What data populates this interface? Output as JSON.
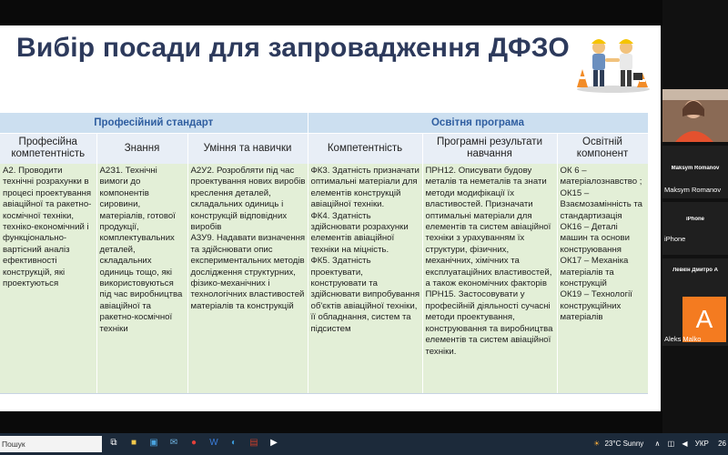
{
  "slide": {
    "title": "Вибір посади для запровадження ДФЗО"
  },
  "table": {
    "group_headers": [
      "Професійний стандарт",
      "Освітня програма"
    ],
    "columns": [
      "Професійна компетентність",
      "Знання",
      "Уміння та навички",
      "Компетентність",
      "Програмні результати навчання",
      "Освітній компонент"
    ],
    "row": [
      "А2. Проводити технічні розрахунки в процесі проектування авіаційної та ракетно-космічної техніки, техніко-економічний і функціонально-вартісний аналіз ефективності конструкцій, які проектуються",
      "А2З1. Технічні вимоги до компонентів сировини, матеріалів, готової продукції, комплектувальних деталей, складальних одиниць тощо, які використовуються під час виробництва авіаційної та ракетно-космічної техніки",
      "А2У2. Розробляти під час проектування нових виробів креслення деталей, складальних одиниць і конструкцій відповідних виробів\nА3У9. Надавати визначення та здійснювати опис експериментальних методів дослідження структурних, фізико-механічних і технологічних властивостей матеріалів та конструкцій",
      "ФК3. Здатність призначати оптимальні матеріали для елементів конструкцій авіаційної техніки.\nФК4. Здатність здійснювати розрахунки елементів авіаційної техніки на міцність.\nФК5. Здатність проектувати, конструювати та здійснювати випробування об'єктів авіаційної техніки, її обладнання, систем та підсистем",
      "ПРН12. Описувати будову металів та неметалів та знати методи модифікації їх властивостей. Призначати оптимальні матеріали для елементів та систем авіаційної техніки з урахуванням їх структури, фізичних, механічних, хімічних та експлуатаційних властивостей, а також економічних факторів\nПРН15. Застосовувати у професійній діяльності сучасні методи проектування, конструювання та виробництва елементів та систем авіаційної техніки.",
      "ОК 6 – матеріалознавство ;\nОК15 – Взаємозамінність та стандартизація\nОК16 – Деталі машин та основи конструювання\nОК17 – Механіка матеріалів та конструкцій\nОК19 – Технології конструкційних матеріалів"
    ]
  },
  "participants": [
    {
      "top_label": "Maksym Romanov",
      "bottom_label": "Maksym Romanov"
    },
    {
      "top_label": "iPhone",
      "bottom_label": "iPhone"
    },
    {
      "top_label": "Левкін Дмитро А",
      "bottom_label": "Aleks Malko",
      "avatar_letter": "A"
    }
  ],
  "taskbar": {
    "search_text": "Пошук",
    "weather": "23°C  Sunny",
    "language": "УКР",
    "clock": "26"
  },
  "colors": {
    "title": "#2d3a5c",
    "group_header_bg": "#ccdff0",
    "group_header_text": "#2f5ea0",
    "body_bg": "#e3efd7",
    "avatar": "#f47b20"
  }
}
